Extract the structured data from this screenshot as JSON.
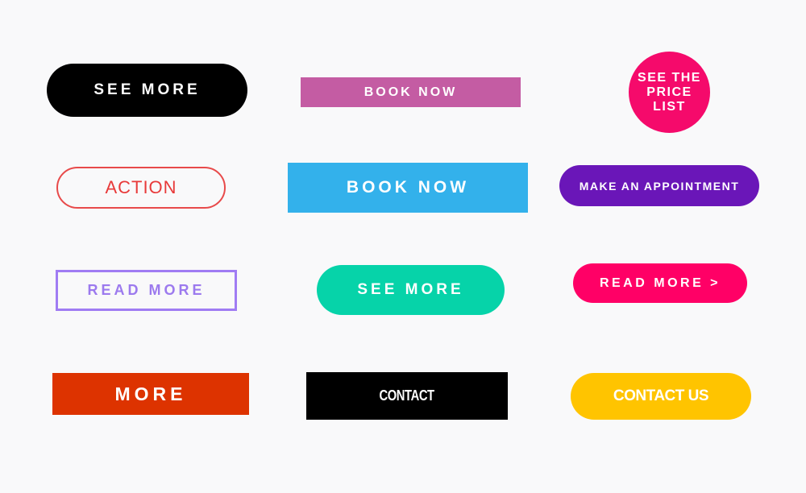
{
  "buttons": {
    "see_more_black": {
      "label": "SEE MORE",
      "color": "#000000"
    },
    "book_now_pink": {
      "label": "BOOK NOW",
      "color": "#c45ca3"
    },
    "see_price_list": {
      "lines": [
        "SEE THE",
        "PRICE",
        "LIST"
      ],
      "color": "#f50a6b"
    },
    "action_outline": {
      "label": "ACTION",
      "color": "#e84a4a"
    },
    "book_now_blue": {
      "label": "BOOK NOW",
      "color": "#33b1eb"
    },
    "make_appointment": {
      "label": "MAKE AN APPOINTMENT",
      "color": "#6a16b8"
    },
    "read_more_outline": {
      "label": "READ MORE",
      "color": "#a07cf3"
    },
    "see_more_green": {
      "label": "SEE MORE",
      "color": "#06d3a9"
    },
    "read_more_pink": {
      "label": "READ MORE >",
      "color": "#ff0066"
    },
    "more_red": {
      "label": "MORE",
      "color": "#dd3300"
    },
    "contact_black": {
      "label": "CONTACT",
      "color": "#000000"
    },
    "contact_us_yellow": {
      "label": "CONTACT US",
      "color": "#ffc400"
    }
  }
}
